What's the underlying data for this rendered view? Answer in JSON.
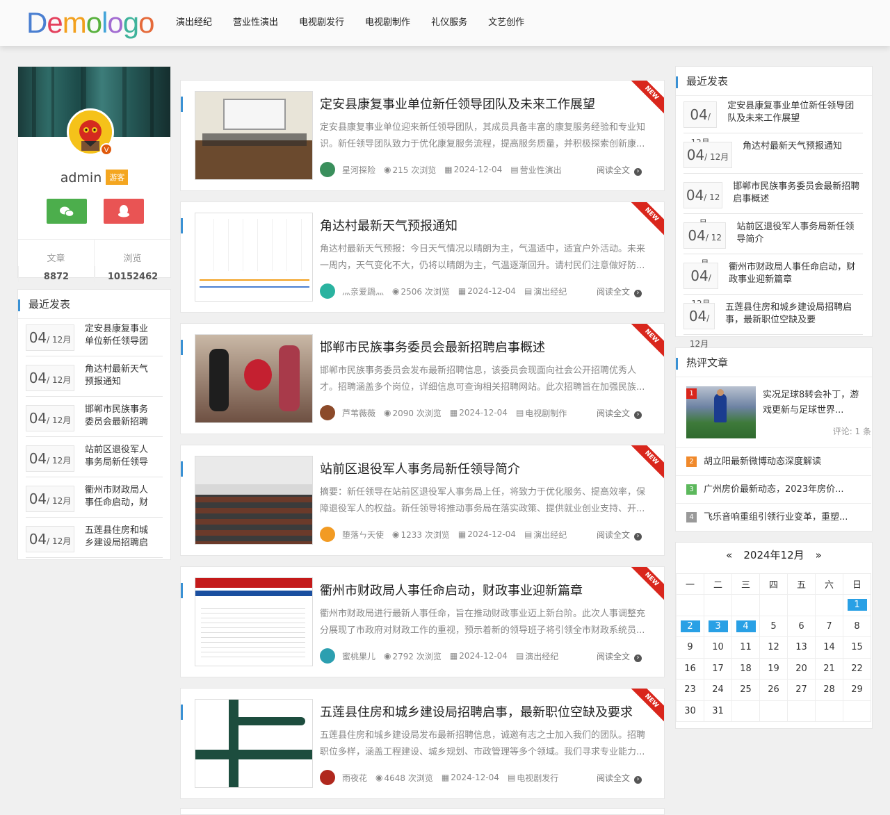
{
  "logo": [
    "D",
    "e",
    "m",
    "o",
    "l",
    "o",
    "g",
    "o"
  ],
  "logo_colors": [
    "#4a7fd1",
    "#e4405d",
    "#f2a01d",
    "#58b13d",
    "#43a4d8",
    "#a26bd1",
    "#3fb39b",
    "#e56a3a"
  ],
  "nav": [
    "演出经纪",
    "营业性演出",
    "电视剧发行",
    "电视剧制作",
    "礼仪服务",
    "文艺创作"
  ],
  "profile": {
    "name": "admin",
    "badge": "游客",
    "stats": [
      {
        "label": "文章",
        "value": "8872"
      },
      {
        "label": "浏览",
        "value": "10152462"
      }
    ],
    "vip": "V"
  },
  "recent_title": "最近发表",
  "left_recent": [
    {
      "day": "04",
      "month": "/ 12月",
      "title": "定安县康复事业单位新任领导团"
    },
    {
      "day": "04",
      "month": "/ 12月",
      "title": "角达村最新天气预报通知"
    },
    {
      "day": "04",
      "month": "/ 12月",
      "title": "邯郸市民族事务委员会最新招聘"
    },
    {
      "day": "04",
      "month": "/ 12月",
      "title": "站前区退役军人事务局新任领导"
    },
    {
      "day": "04",
      "month": "/ 12月",
      "title": "衢州市财政局人事任命启动，财"
    },
    {
      "day": "04",
      "month": "/ 12月",
      "title": "五莲县住房和城乡建设局招聘启"
    }
  ],
  "right_recent": [
    {
      "day": "04",
      "month": "/ 12月",
      "title": "定安县康复事业单位新任领导团队及未来工作展望"
    },
    {
      "day": "04",
      "month": "/ 12月",
      "title": "角达村最新天气预报通知"
    },
    {
      "day": "04",
      "month": "/ 12月",
      "title": "邯郸市民族事务委员会最新招聘启事概述"
    },
    {
      "day": "04",
      "month": "/ 12月",
      "title": "站前区退役军人事务局新任领导简介"
    },
    {
      "day": "04",
      "month": "/ 12月",
      "title": "衢州市财政局人事任命启动，财政事业迎新篇章"
    },
    {
      "day": "04",
      "month": "/ 12月",
      "title": "五莲县住房和城乡建设局招聘启事，最新职位空缺及要"
    }
  ],
  "ribbon": "NEW",
  "read_more": "阅读全文",
  "articles": [
    {
      "title": "定安县康复事业单位新任领导团队及未来工作展望",
      "desc": "定安县康复事业单位迎来新任领导团队，其成员具备丰富的康复服务经验和专业知识。新任领导团队致力于优化康复服务流程，提高服务质量，并积极探索创新康...",
      "author": "星河探险",
      "views": "215 次浏览",
      "date": "2024-12-04",
      "cat": "营业性演出",
      "av": "#3a8f5c"
    },
    {
      "title": "角达村最新天气预报通知",
      "desc": "角达村最新天气预报：今日天气情况以晴朗为主，气温适中，适宜户外活动。未来一周内，天气变化不大，仍将以晴朗为主，气温逐渐回升。请村民们注意做好防...",
      "author": "灬亲爱踻灬",
      "views": "2506 次浏览",
      "date": "2024-12-04",
      "cat": "演出经纪",
      "av": "#2ab3a0"
    },
    {
      "title": "邯郸市民族事务委员会最新招聘启事概述",
      "desc": "邯郸市民族事务委员会发布最新招聘信息，该委员会现面向社会公开招聘优秀人才。招聘涵盖多个岗位，详细信息可查询相关招聘网站。此次招聘旨在加强民族...",
      "author": "芦苇薇薇",
      "views": "2090 次浏览",
      "date": "2024-12-04",
      "cat": "电视剧制作",
      "av": "#8c4a2a"
    },
    {
      "title": "站前区退役军人事务局新任领导简介",
      "desc": "摘要：新任领导在站前区退役军人事务局上任，将致力于优化服务、提高效率，保障退役军人的权益。新任领导将推动事务局在落实政策、提供就业创业支持、开...",
      "author": "堕落ㄣ天使",
      "views": "1233 次浏览",
      "date": "2024-12-04",
      "cat": "演出经纪",
      "av": "#f29b23"
    },
    {
      "title": "衢州市财政局人事任命启动，财政事业迎新篇章",
      "desc": "衢州市财政局进行最新人事任命，旨在推动财政事业迈上新台阶。此次人事调整充分展现了市政府对财政工作的重视，预示着新的领导班子将引领全市财政系统员...",
      "author": "蜜桃果儿",
      "views": "2792 次浏览",
      "date": "2024-12-04",
      "cat": "演出经纪",
      "av": "#2c9fb0"
    },
    {
      "title": "五莲县住房和城乡建设局招聘启事，最新职位空缺及要求",
      "desc": "五莲县住房和城乡建设局发布最新招聘信息，诚邀有志之士加入我们的团队。招聘职位多样，涵盖工程建设、城乡规划、市政管理等多个领域。我们寻求专业能力...",
      "author": "雨夜花",
      "views": "4648 次浏览",
      "date": "2024-12-04",
      "cat": "电视剧发行",
      "av": "#b0281e"
    }
  ],
  "hot_title": "热评文章",
  "hot_first": {
    "num": "1",
    "title": "实况足球8转会补丁，游戏更新与足球世界...",
    "comment": "评论: 1 条"
  },
  "hot_list": [
    {
      "num": "2",
      "title": "胡立阳最新微博动态深度解读",
      "color": "#f0892b"
    },
    {
      "num": "3",
      "title": "广州房价最新动态，2023年房价...",
      "color": "#5cb85c"
    },
    {
      "num": "4",
      "title": "飞乐音响重组引领行业变革，重塑...",
      "color": "#999999"
    }
  ],
  "calendar": {
    "prev": "«",
    "title": "2024年12月",
    "next": "»",
    "weekdays": [
      "一",
      "二",
      "三",
      "四",
      "五",
      "六",
      "日"
    ],
    "rows": [
      [
        "",
        "",
        "",
        "",
        "",
        "",
        "1"
      ],
      [
        "2",
        "3",
        "4",
        "5",
        "6",
        "7",
        "8"
      ],
      [
        "9",
        "10",
        "11",
        "12",
        "13",
        "14",
        "15"
      ],
      [
        "16",
        "17",
        "18",
        "19",
        "20",
        "21",
        "22"
      ],
      [
        "23",
        "24",
        "25",
        "26",
        "27",
        "28",
        "29"
      ],
      [
        "30",
        "31",
        "",
        "",
        "",
        "",
        ""
      ]
    ],
    "highlight": [
      "1",
      "2",
      "3",
      "4"
    ]
  }
}
